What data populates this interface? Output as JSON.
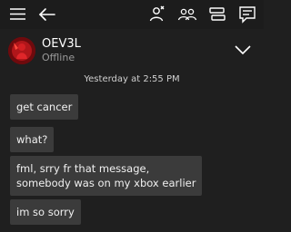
{
  "header": {
    "menu_icon": "hamburger-menu-icon",
    "back_icon": "back-arrow-icon",
    "actions": [
      "people-icon",
      "party-icon",
      "messages-icon",
      "chat-icon"
    ]
  },
  "conversation": {
    "gamertag": "OEV3L",
    "status": "Offline",
    "expand_icon": "chevron-down-icon"
  },
  "thread": {
    "timestamp": "Yesterday at 2:55 PM",
    "messages": [
      "get cancer",
      "what?",
      "fml, srry fr that message,\nsomebody was on my xbox earlier",
      "im so sorry"
    ]
  },
  "colors": {
    "background": "#1f1f1f",
    "bubble": "#3b3b3b",
    "avatar_red": "#b0161a"
  }
}
